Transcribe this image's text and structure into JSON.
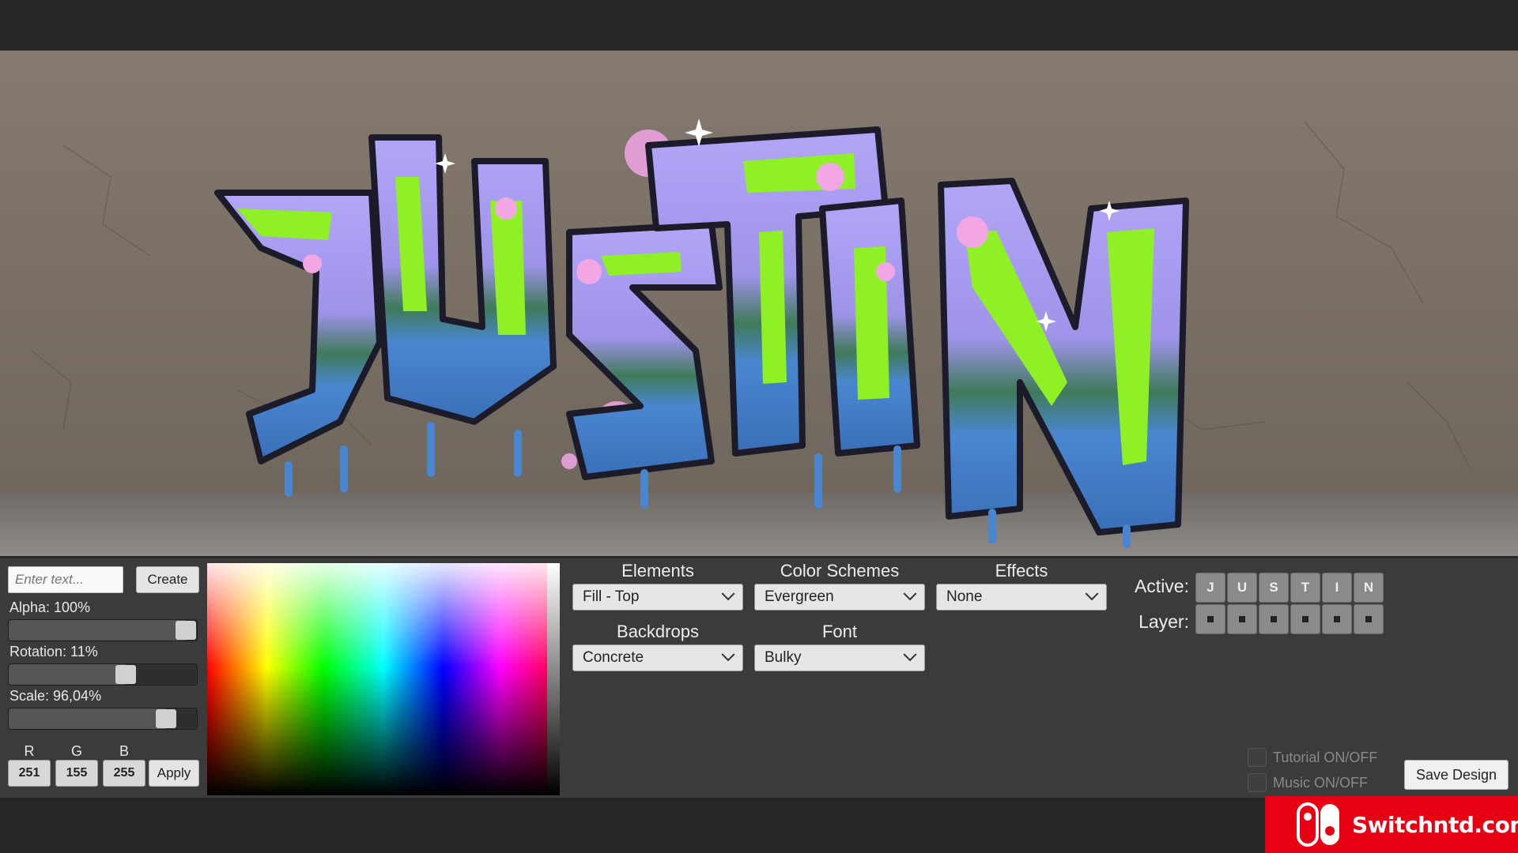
{
  "artwork": {
    "text": "JUSTIN",
    "letters": [
      "J",
      "U",
      "S",
      "T",
      "I",
      "N"
    ]
  },
  "controls": {
    "text_input_placeholder": "Enter text...",
    "create_label": "Create",
    "alpha": {
      "label": "Alpha: 100%",
      "value": 1.0
    },
    "rotation": {
      "label": "Rotation: 11%",
      "value": 0.64
    },
    "scale": {
      "label": "Scale: 96,04%",
      "value": 0.88
    },
    "rgb": {
      "r_label": "R",
      "g_label": "G",
      "b_label": "B",
      "r": "251",
      "g": "155",
      "b": "255"
    },
    "apply_label": "Apply"
  },
  "dropdowns": {
    "elements": {
      "label": "Elements",
      "value": "Fill - Top"
    },
    "color_schemes": {
      "label": "Color Schemes",
      "value": "Evergreen"
    },
    "effects": {
      "label": "Effects",
      "value": "None"
    },
    "backdrops": {
      "label": "Backdrops",
      "value": "Concrete"
    },
    "font": {
      "label": "Font",
      "value": "Bulky"
    }
  },
  "letters_panel": {
    "active_label": "Active:",
    "layer_label": "Layer:",
    "letters": [
      "J",
      "U",
      "S",
      "T",
      "I",
      "N"
    ]
  },
  "toggles": {
    "tutorial": "Tutorial ON/OFF",
    "music": "Music ON/OFF"
  },
  "save_label": "Save Design",
  "watermark": {
    "text": "Switchntd.com",
    "color": "#e60012"
  },
  "colors": {
    "graffiti_fill": "#a99cf5",
    "graffiti_accent": "#8ef025",
    "graffiti_drip": "#4a86d0",
    "wall": "#7d7268",
    "panel": "#3b3b3b"
  }
}
